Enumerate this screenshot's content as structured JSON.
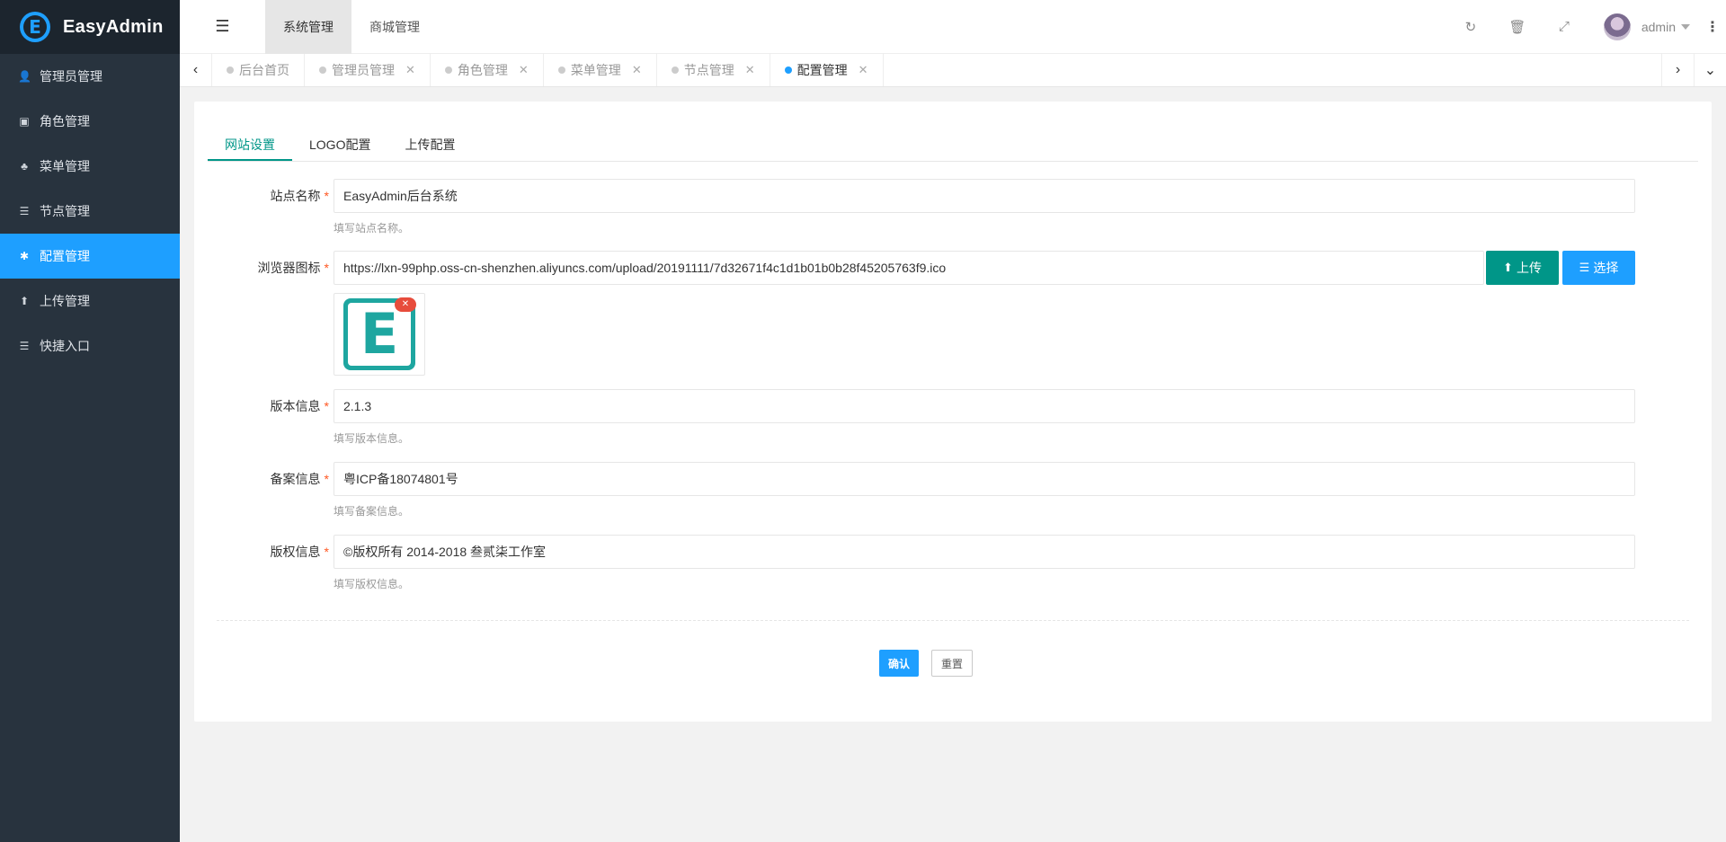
{
  "app": {
    "name": "EasyAdmin",
    "logo_letter": "E"
  },
  "sidebar": {
    "items": [
      {
        "label": "管理员管理",
        "icon": "user-icon",
        "glyph": "👤"
      },
      {
        "label": "角色管理",
        "icon": "id-card-icon",
        "glyph": "▣"
      },
      {
        "label": "菜单管理",
        "icon": "tree-icon",
        "glyph": "♣"
      },
      {
        "label": "节点管理",
        "icon": "list-icon",
        "glyph": "☰"
      },
      {
        "label": "配置管理",
        "icon": "asterisk-icon",
        "glyph": "✱",
        "active": true
      },
      {
        "label": "上传管理",
        "icon": "arrow-up-icon",
        "glyph": "⬆"
      },
      {
        "label": "快捷入口",
        "icon": "list-icon",
        "glyph": "☰"
      }
    ]
  },
  "header": {
    "top_nav": [
      "系统管理",
      "商城管理"
    ],
    "username": "admin"
  },
  "tabs": {
    "items": [
      {
        "label": "后台首页",
        "closable": false
      },
      {
        "label": "管理员管理",
        "closable": true
      },
      {
        "label": "角色管理",
        "closable": true
      },
      {
        "label": "菜单管理",
        "closable": true
      },
      {
        "label": "节点管理",
        "closable": true
      },
      {
        "label": "配置管理",
        "closable": true,
        "active": true
      }
    ]
  },
  "form": {
    "tabs": [
      "网站设置",
      "LOGO配置",
      "上传配置"
    ],
    "site_name": {
      "label": "站点名称",
      "value": "EasyAdmin后台系统",
      "tip": "填写站点名称。"
    },
    "favicon": {
      "label": "浏览器图标",
      "value": "https://lxn-99php.oss-cn-shenzhen.aliyuncs.com/upload/20191111/7d32671f4c1d1b01b0b28f45205763f9.ico",
      "upload_label": "上传",
      "select_label": "选择"
    },
    "version": {
      "label": "版本信息",
      "value": "2.1.3",
      "tip": "填写版本信息。"
    },
    "icp": {
      "label": "备案信息",
      "value": "粤ICP备18074801号",
      "tip": "填写备案信息。"
    },
    "copyright": {
      "label": "版权信息",
      "value": "©版权所有 2014-2018 叁贰柒工作室",
      "tip": "填写版权信息。"
    },
    "submit_label": "确认",
    "reset_label": "重置"
  },
  "colors": {
    "primary": "#1e9fff",
    "green": "#009688",
    "sidebar": "#28333e",
    "danger": "#e74c3c"
  }
}
